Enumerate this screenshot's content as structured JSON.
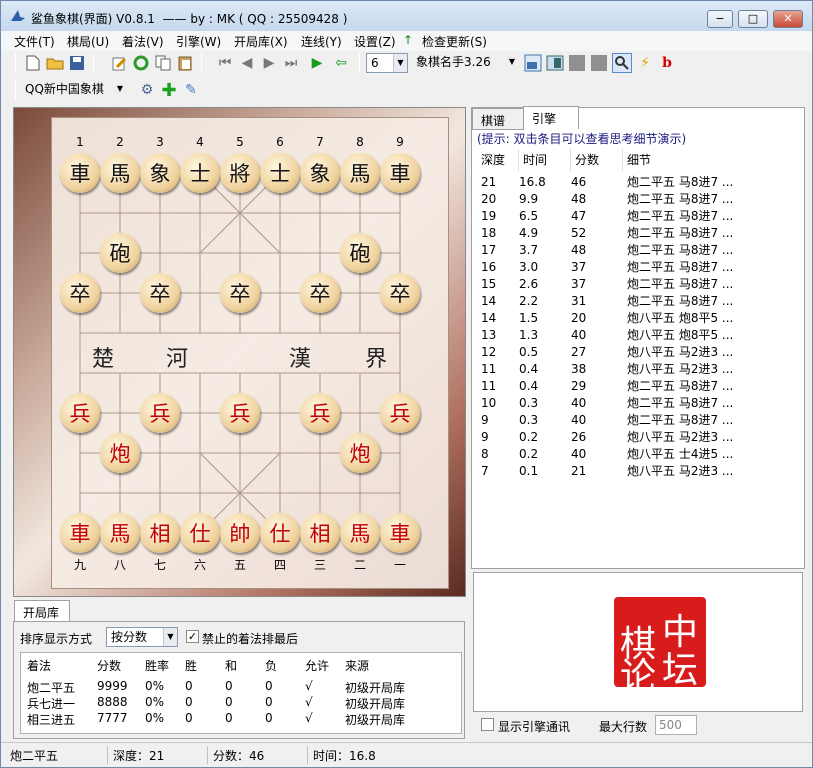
{
  "window": {
    "title": "鲨鱼象棋(界面) V0.8.1  —— by : MK ( QQ : 25509428 )",
    "min_label": "−",
    "max_label": "□",
    "close_label": "✕"
  },
  "menu": [
    "文件(T)",
    "棋局(U)",
    "着法(V)",
    "引擎(W)",
    "开局库(X)",
    "连线(Y)",
    "设置(Z)",
    "检查更新(S)"
  ],
  "toolbar": {
    "depth_value": "6",
    "engine_value": "象棋名手3.26",
    "style_value": "QQ新中国象棋"
  },
  "board": {
    "file_numbers_top": [
      "1",
      "2",
      "3",
      "4",
      "5",
      "6",
      "7",
      "8",
      "9"
    ],
    "file_numbers_bottom": [
      "九",
      "八",
      "七",
      "六",
      "五",
      "四",
      "三",
      "二",
      "一"
    ],
    "river_left": [
      "楚",
      "河"
    ],
    "river_right": [
      "漢",
      "界"
    ],
    "black_back": [
      "車",
      "馬",
      "象",
      "士",
      "將",
      "士",
      "象",
      "馬",
      "車"
    ],
    "black_cannon": "砲",
    "black_pawn": "卒",
    "red_back": [
      "車",
      "馬",
      "相",
      "仕",
      "帥",
      "仕",
      "相",
      "馬",
      "車"
    ],
    "red_cannon": "炮",
    "red_pawn": "兵"
  },
  "right_tabs": {
    "tab1": "棋谱",
    "tab2": "引擎"
  },
  "hint": "(提示: 双击条目可以查看思考细节演示)",
  "engine_headers": [
    "深度",
    "时间",
    "分数",
    "细节"
  ],
  "engine_rows": [
    [
      "21",
      "16.8",
      "46",
      "炮二平五  马8进7  ..."
    ],
    [
      "20",
      "9.9",
      "48",
      "炮二平五  马8进7  ..."
    ],
    [
      "19",
      "6.5",
      "47",
      "炮二平五  马8进7  ..."
    ],
    [
      "18",
      "4.9",
      "52",
      "炮二平五  马8进7  ..."
    ],
    [
      "17",
      "3.7",
      "48",
      "炮二平五  马8进7  ..."
    ],
    [
      "16",
      "3.0",
      "37",
      "炮二平五  马8进7  ..."
    ],
    [
      "15",
      "2.6",
      "37",
      "炮二平五  马8进7  ..."
    ],
    [
      "14",
      "2.2",
      "31",
      "炮二平五  马8进7  ..."
    ],
    [
      "14",
      "1.5",
      "20",
      "炮八平五  炮8平5  ..."
    ],
    [
      "13",
      "1.3",
      "40",
      "炮八平五  炮8平5  ..."
    ],
    [
      "12",
      "0.5",
      "27",
      "炮八平五  马2进3  ..."
    ],
    [
      "11",
      "0.4",
      "38",
      "炮八平五  马2进3  ..."
    ],
    [
      "11",
      "0.4",
      "29",
      "炮二平五  马8进7  ..."
    ],
    [
      "10",
      "0.3",
      "40",
      "炮二平五  马8进7  ..."
    ],
    [
      "9",
      "0.3",
      "40",
      "炮二平五  马8进7  ..."
    ],
    [
      "9",
      "0.2",
      "26",
      "炮八平五  马2进3  ..."
    ],
    [
      "8",
      "0.2",
      "40",
      "炮八平五  士4进5  ..."
    ],
    [
      "7",
      "0.1",
      "21",
      "炮八平五  马2进3  ..."
    ]
  ],
  "logo": {
    "c1": "中",
    "c2": "棋",
    "c3": "论",
    "c4": "坛"
  },
  "engine_opts": {
    "show_comm_label": "显示引擎通讯",
    "max_rows_label": "最大行数",
    "max_rows_value": "500"
  },
  "opening": {
    "tab": "开局库",
    "sort_label": "排序显示方式",
    "sort_value": "按分数",
    "ban_label": "禁止的着法排最后",
    "headers": [
      "着法",
      "分数",
      "胜率",
      "胜",
      "和",
      "负",
      "允许",
      "来源"
    ],
    "rows": [
      [
        "炮二平五",
        "9999",
        "0%",
        "0",
        "0",
        "0",
        "√",
        "初级开局库"
      ],
      [
        "兵七进一",
        "8888",
        "0%",
        "0",
        "0",
        "0",
        "√",
        "初级开局库"
      ],
      [
        "相三进五",
        "7777",
        "0%",
        "0",
        "0",
        "0",
        "√",
        "初级开局库"
      ]
    ]
  },
  "status": {
    "move": "炮二平五",
    "depth": "深度：21",
    "score": "分数：46",
    "time": "时间：16.8"
  },
  "colors": {
    "red_piece": "#c0000a",
    "logo_red": "#d81c1c",
    "accent": "#0050c8"
  }
}
